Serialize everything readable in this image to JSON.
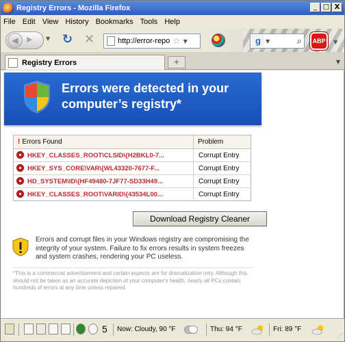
{
  "window": {
    "title": "Registry Errors - Mozilla Firefox",
    "buttons": {
      "minimize": "_",
      "maximize": "□",
      "close": "X"
    }
  },
  "menu": [
    "File",
    "Edit",
    "View",
    "History",
    "Bookmarks",
    "Tools",
    "Help"
  ],
  "toolbar": {
    "url": "http://error-repo",
    "search_engine": "g",
    "search_value": "",
    "adblock_label": "ABP"
  },
  "tab": {
    "label": "Registry Errors",
    "new_tab": "+"
  },
  "page": {
    "hero_title": "Errors were detected in your computer’s registry*",
    "table": {
      "headers": {
        "errors": "Errors Found",
        "problem": "Problem",
        "marker": "!"
      },
      "rows": [
        {
          "key": "HKEY_CLASSES_ROOT\\CLSID\\{H2BKL0-7...",
          "problem": "Corrupt Entry"
        },
        {
          "key": "HKEY_SYS_CORE\\VAR\\{WL43320-7677-F...",
          "problem": "Corrupt Entry"
        },
        {
          "key": "HD_SYSTEM\\ID\\{HF49480-7JF77-SD33H49...",
          "problem": "Corrupt Entry"
        },
        {
          "key": "HKEY_CLASSES_ROOT\\VARID\\{43534L00...",
          "problem": "Corrupt Entry"
        }
      ]
    },
    "download_button": "Download Registry Cleaner",
    "warning_text": "Errors and corrupt files in your Windows registry are compromising the integrity of your system. Failure to fix errors results in system freezes and system crashes, rendering your PC useless.",
    "disclaimer": "*This is a commercial advertisement and certain aspects are for dramatization only. Although this should not be taken as an accurate depiction of your computer's health, nearly all PCs contain hundreds of errors at any time unless repaired."
  },
  "statusbar": {
    "counter": "5",
    "now_weather": "Now: Cloudy, 90 °F",
    "thu_weather": "Thu: 94 °F",
    "fri_weather": "Fri: 89 °F"
  },
  "colors": {
    "hero_blue": "#1f5fc8",
    "error_red": "#c0282d",
    "adblock_red": "#d51818"
  }
}
